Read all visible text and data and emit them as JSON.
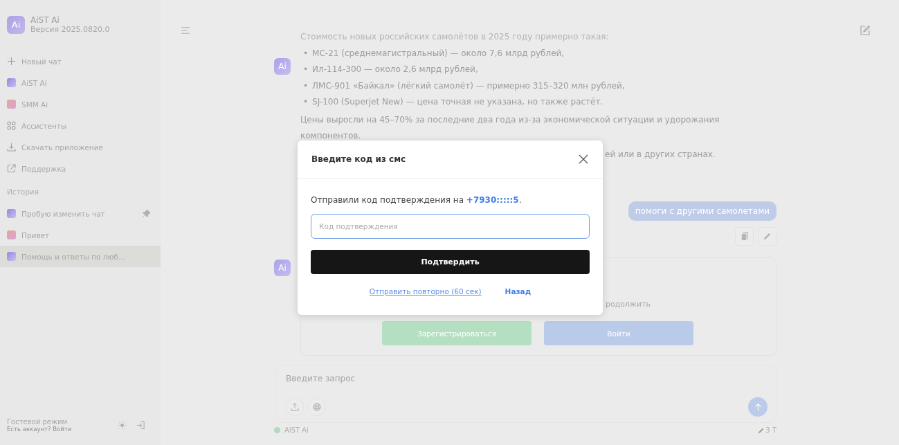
{
  "sidebar": {
    "logo": "Ai",
    "app_name": "AiST Ai",
    "version": "Версия 2025.0820.0",
    "menu": [
      {
        "kind": "new",
        "label": "Новый чат"
      },
      {
        "kind": "aist",
        "label": "AiST Ai"
      },
      {
        "kind": "smm",
        "label": "SMM Ai"
      },
      {
        "kind": "grid",
        "label": "Ассистенты"
      },
      {
        "kind": "download",
        "label": "Скачать приложение"
      },
      {
        "kind": "support",
        "label": "Поддержка"
      }
    ],
    "history_title": "История",
    "history": [
      {
        "kind": "aist",
        "label": "Пробую изменить чат",
        "pinned": true,
        "selected": false
      },
      {
        "kind": "smm",
        "label": "Привет",
        "pinned": false,
        "selected": false
      },
      {
        "kind": "aist",
        "label": "Помощь и ответы по люб...",
        "pinned": false,
        "selected": true
      }
    ],
    "footer": {
      "mode": "Гостевой режим",
      "login_hint": "Есть аккаунт? Войти"
    }
  },
  "chat": {
    "assistant_message": {
      "avatar": "Ai",
      "intro": "Стоимость новых российских самолётов в 2025 году примерно такая:",
      "bullet_marker": "•",
      "bullets": [
        "МС-21 (среднемагистральный) — около 7,6 млрд рублей,",
        "Ил-114-300 — около 2,6 млрд рублей,",
        "ЛМС-901 «Байкал» (лёгкий самолёт) — примерно 315–320 млн рублей,",
        "SJ-100 (Superjet New) — цена точная не указана, но также растёт."
      ],
      "paragraph": "Цены выросли на 45–70% за последние два года из-за экономической ситуации и удорожания компонентов.",
      "partial_line": "ей или в других странах."
    },
    "user_message": "помоги с другими самолетами",
    "login_card": {
      "avatar": "Ai",
      "partial_text": "родолжить",
      "buttons": [
        {
          "kind": "register",
          "label": "Зарегистрироваться"
        },
        {
          "kind": "login",
          "label": "Войти"
        }
      ]
    },
    "composer": {
      "placeholder": "Введите запрос"
    },
    "model_name": "AiST Ai",
    "tokens": "3 T"
  },
  "modal": {
    "title": "Введите код из смс",
    "message": "Отправили код подтверждения на",
    "phone": "+7930:::::5",
    "message_end": ".",
    "code_field": {
      "placeholder": "Код подтверждения"
    },
    "confirm": "Подтвердить",
    "resend": "Отправить повторно (60 сек)",
    "back": "Назад"
  }
}
